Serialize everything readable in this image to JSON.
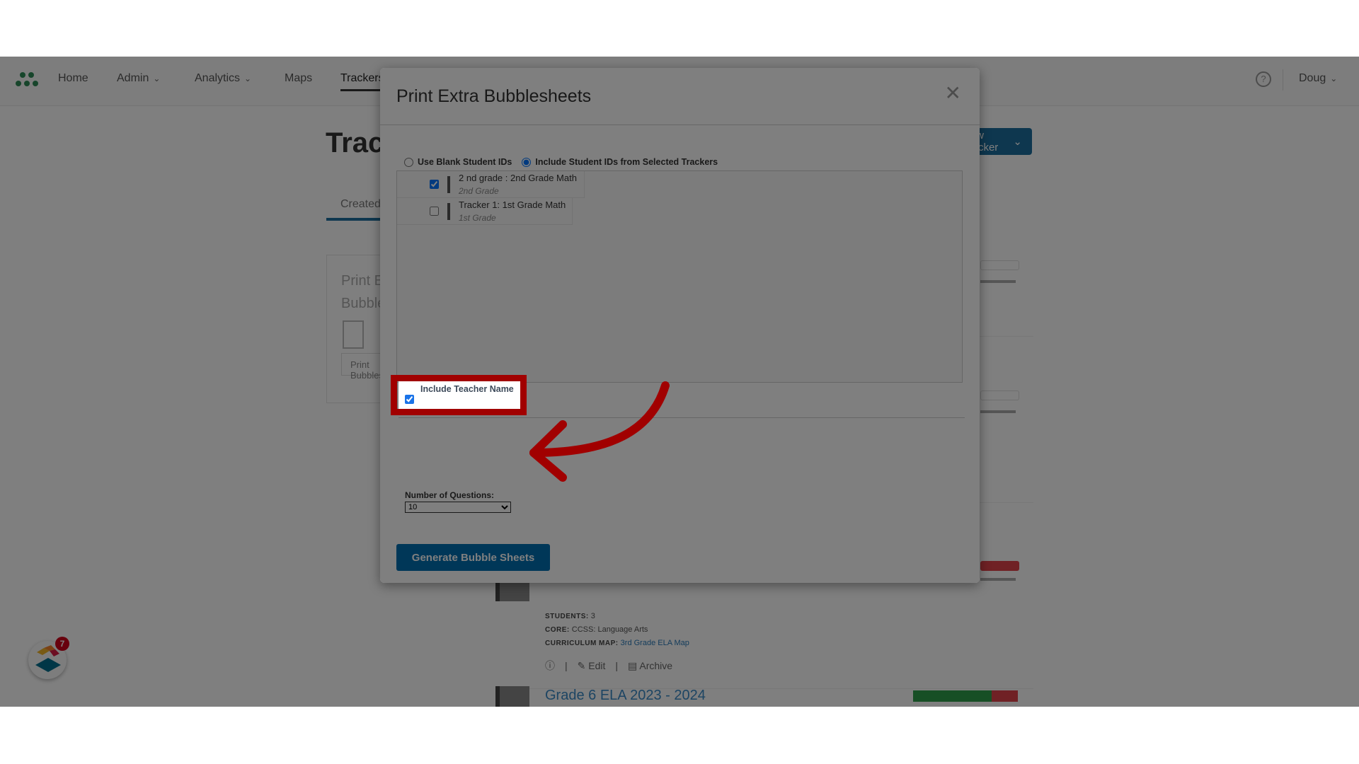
{
  "nav": {
    "items": [
      {
        "label": "Home",
        "has_dropdown": false
      },
      {
        "label": "Admin",
        "has_dropdown": true
      },
      {
        "label": "Analytics",
        "has_dropdown": true
      },
      {
        "label": "Maps",
        "has_dropdown": false
      },
      {
        "label": "Trackers",
        "has_dropdown": false,
        "active": true
      }
    ],
    "help_icon": "?",
    "user_name": "Doug",
    "chevron": "⌄"
  },
  "page": {
    "title": "Trackers",
    "new_button_label": "New Tracker",
    "tab_created": "Created",
    "side_card": {
      "title_line1": "Print Extra",
      "title_line2": "Bubblesheets",
      "button_label": "Print Bubblesheets"
    },
    "tracker_meta": {
      "students_label": "STUDENTS:",
      "students_value": "3",
      "core_label": "CORE:",
      "core_value": "CCSS: Language Arts",
      "curriculum_label": "CURRICULUM MAP:",
      "curriculum_value": "3rd Grade ELA Map",
      "edit_label": "Edit",
      "archive_label": "Archive"
    },
    "next_tracker_title": "Grade 6 ELA 2023 - 2024",
    "progress": {
      "correct_fraction": 0.75,
      "incorrect_fraction": 0.25
    }
  },
  "chat": {
    "badge_count": "7"
  },
  "modal": {
    "title": "Print Extra Bubblesheets",
    "close_icon": "✕",
    "radio_options": [
      {
        "label": "Use Blank Student IDs",
        "checked": false
      },
      {
        "label": "Include Student IDs from Selected Trackers",
        "checked": true
      }
    ],
    "trackers": [
      {
        "name": "2 nd grade : 2nd Grade Math",
        "grade": "2nd Grade",
        "checked": true
      },
      {
        "name": "Tracker 1: 1st Grade Math",
        "grade": "1st Grade",
        "checked": false
      }
    ],
    "include_teacher_name": {
      "label": "Include Teacher Name",
      "checked": true
    },
    "number_of_questions": {
      "label": "Number of Questions:",
      "value": "10"
    },
    "generate_button": "Generate Bubble Sheets"
  },
  "annotation": {
    "color": "#a10000"
  }
}
